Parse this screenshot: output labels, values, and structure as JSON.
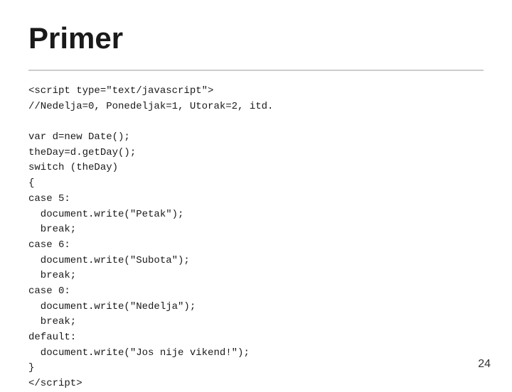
{
  "slide": {
    "title": "Primer",
    "page_number": "24",
    "code": "<script type=\"text/javascript\">\n//Nedelja=0, Ponedeljak=1, Utorak=2, itd.\n\nvar d=new Date();\ntheDay=d.getDay();\nswitch (theDay)\n{\ncase 5:\n  document.write(\"Petak\");\n  break;\ncase 6:\n  document.write(\"Subota\");\n  break;\ncase 0:\n  document.write(\"Nedelja\");\n  break;\ndefault:\n  document.write(\"Jos nije vikend!\");\n}\n</script>"
  }
}
